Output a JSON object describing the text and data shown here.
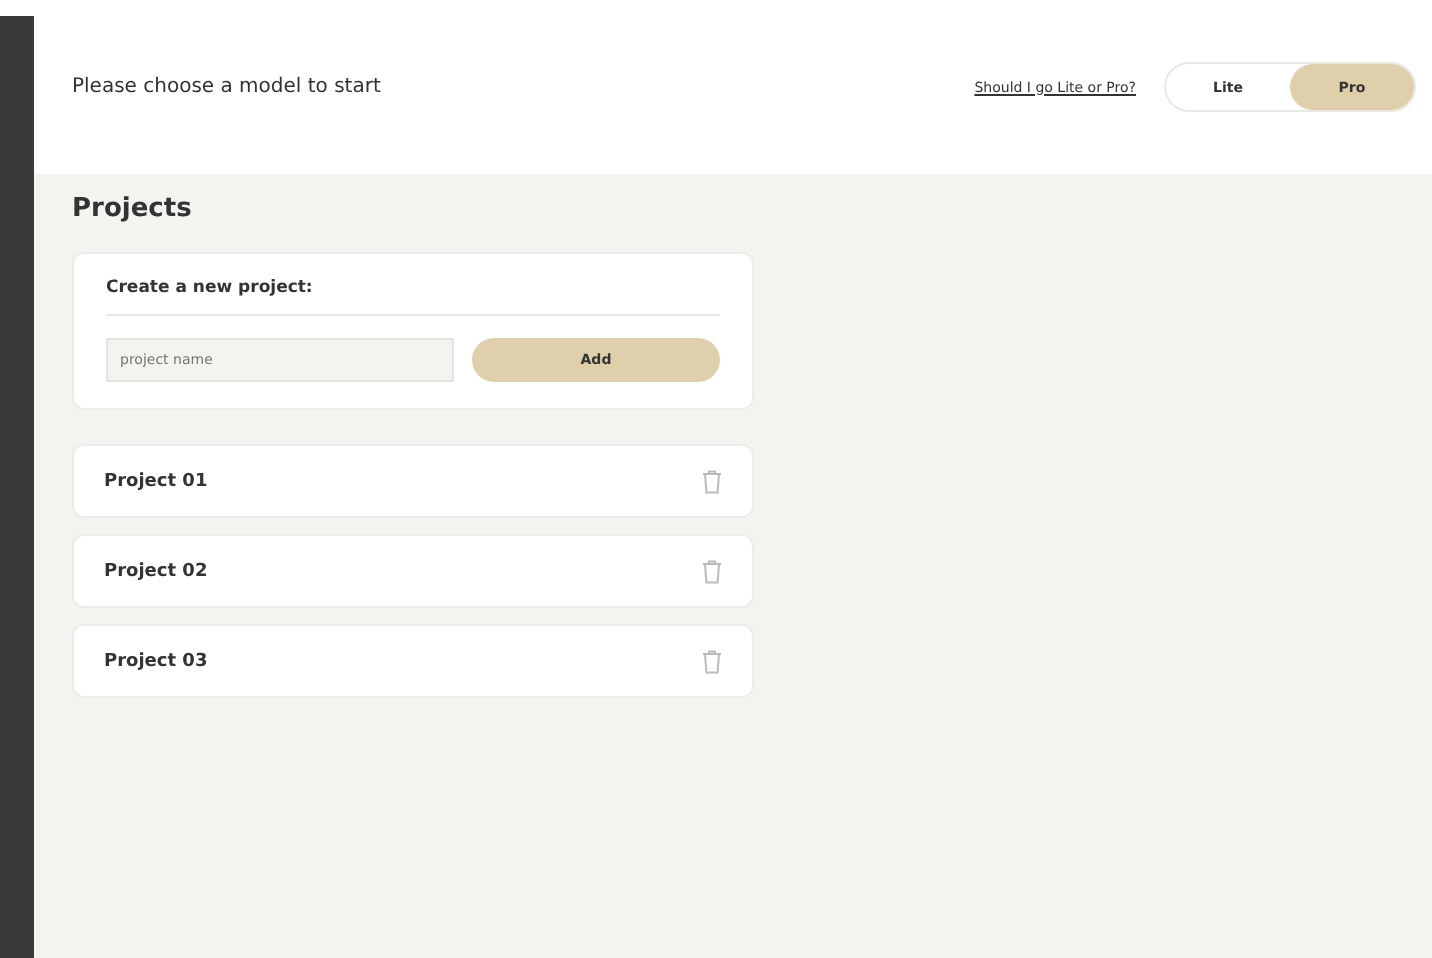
{
  "header": {
    "prompt": "Please choose a model to start",
    "help_link": "Should I go Lite or Pro?",
    "model_options": [
      {
        "label": "Lite",
        "selected": false
      },
      {
        "label": "Pro",
        "selected": true
      }
    ]
  },
  "projects": {
    "title": "Projects",
    "create": {
      "title": "Create a new project:",
      "input": {
        "placeholder": "project name"
      },
      "button": "Add"
    },
    "items": [
      {
        "name": "Project 01"
      },
      {
        "name": "Project 02"
      },
      {
        "name": "Project 03"
      }
    ]
  }
}
